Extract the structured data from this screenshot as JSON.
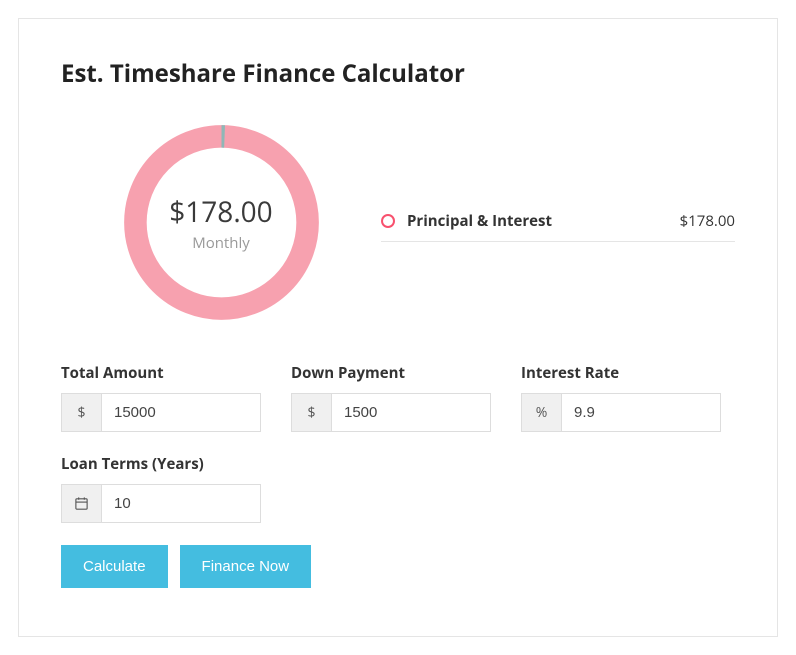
{
  "title": "Est. Timeshare Finance Calculator",
  "chart": {
    "amount": "$178.00",
    "period": "Monthly",
    "color": "#f7a1af",
    "gap_color": "#8fb7b7"
  },
  "legend": {
    "item_label": "Principal & Interest",
    "item_value": "$178.00"
  },
  "fields": {
    "total_amount": {
      "label": "Total Amount",
      "prefix": "$",
      "value": "15000"
    },
    "down_payment": {
      "label": "Down Payment",
      "prefix": "$",
      "value": "1500"
    },
    "interest_rate": {
      "label": "Interest Rate",
      "prefix": "%",
      "value": "9.9"
    },
    "loan_terms": {
      "label": "Loan Terms (Years)",
      "value": "10"
    }
  },
  "buttons": {
    "calculate": "Calculate",
    "finance_now": "Finance Now"
  }
}
